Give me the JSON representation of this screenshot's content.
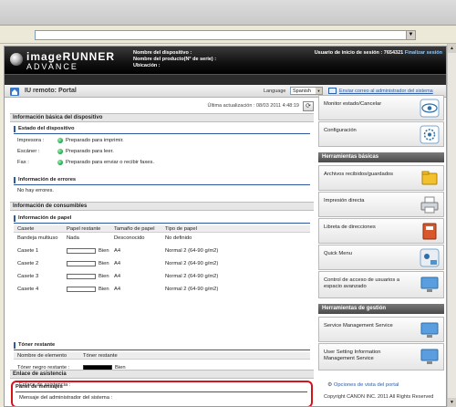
{
  "header": {
    "brand_main": "imageRUNNER",
    "brand_sub": "ADVANCE",
    "device_name_label": "Nombre del dispositivo :",
    "product_name_label": "Nombre del producto(N° de serie) :",
    "location_label": "Ubicación :",
    "user_label": "Usuario de inicio de sesión : 7654321",
    "logout_label": "Finalizar sesión"
  },
  "titlebar": {
    "title": "IU remoto: Portal",
    "language_label": "Language",
    "language_value": "Spanish",
    "mail_link": "Enviar correo al administrador del sistema"
  },
  "main": {
    "last_update": "Última actualización : 08/03 2011 4:48:19",
    "basic_info_title": "Información básica del dispositivo",
    "device_status_title": "Estado del dispositivo",
    "status_rows": [
      {
        "label": "Impresora :",
        "value": "Preparado para imprimir."
      },
      {
        "label": "Escáner :",
        "value": "Preparado para leer."
      },
      {
        "label": "Fax :",
        "value": "Preparado para enviar o recibir faxes."
      }
    ],
    "error_info_title": "Información de errores",
    "error_text": "No hay errores.",
    "consumables_title": "Información de consumibles",
    "paper_info_title": "Información de papel",
    "paper_headers": [
      "Casete",
      "Papel restante",
      "Tamaño de papel",
      "Tipo de papel"
    ],
    "paper_rows": [
      {
        "cassette": "Bandeja multiuso",
        "remaining": "Nada",
        "size": "Desconocido",
        "type": "No definido",
        "bar": false
      },
      {
        "cassette": "Casete 1",
        "remaining": "Bien",
        "size": "A4",
        "type": "Normal 2 (64-90 g/m2)",
        "bar": true
      },
      {
        "cassette": "Casete 2",
        "remaining": "Bien",
        "size": "A4",
        "type": "Normal 2 (64-90 g/m2)",
        "bar": true
      },
      {
        "cassette": "Casete 3",
        "remaining": "Bien",
        "size": "A4",
        "type": "Normal 2 (64-90 g/m2)",
        "bar": true
      },
      {
        "cassette": "Casete 4",
        "remaining": "Bien",
        "size": "A4",
        "type": "Normal 2 (64-90 g/m2)",
        "bar": true
      }
    ],
    "toner_title": "Tóner restante",
    "toner_headers": [
      "Nombre de elemento",
      "Tóner restante"
    ],
    "toner_row_label": "Tóner negro restante :",
    "toner_row_value": "Bien",
    "message_panel_title": "Panel de mensajes",
    "message_text": "Mensaje del administrador del sistema :",
    "support_title": "Enlace de asistencia",
    "support_text": "Enlace de asistencia :"
  },
  "sidebar": {
    "status_monitor": "Monitor estado/Cancelar",
    "settings": "Configuración",
    "basic_tools_title": "Herramientas básicas",
    "received_files": "Archivos recibidos/guardados",
    "direct_print": "Impresión directa",
    "address_book": "Libreta de direcciones",
    "quick_menu": "Quick Menu",
    "access_control": "Control de acceso de usuarios a espacio avanzado",
    "mgmt_tools_title": "Herramientas de gestión",
    "service_mgmt": "Service Management Service",
    "user_setting": "User Setting Information Management Service",
    "portal_options": "Opciones de vista del portal",
    "copyright": "Copyright CANON INC. 2011 All Rights Reserved"
  }
}
